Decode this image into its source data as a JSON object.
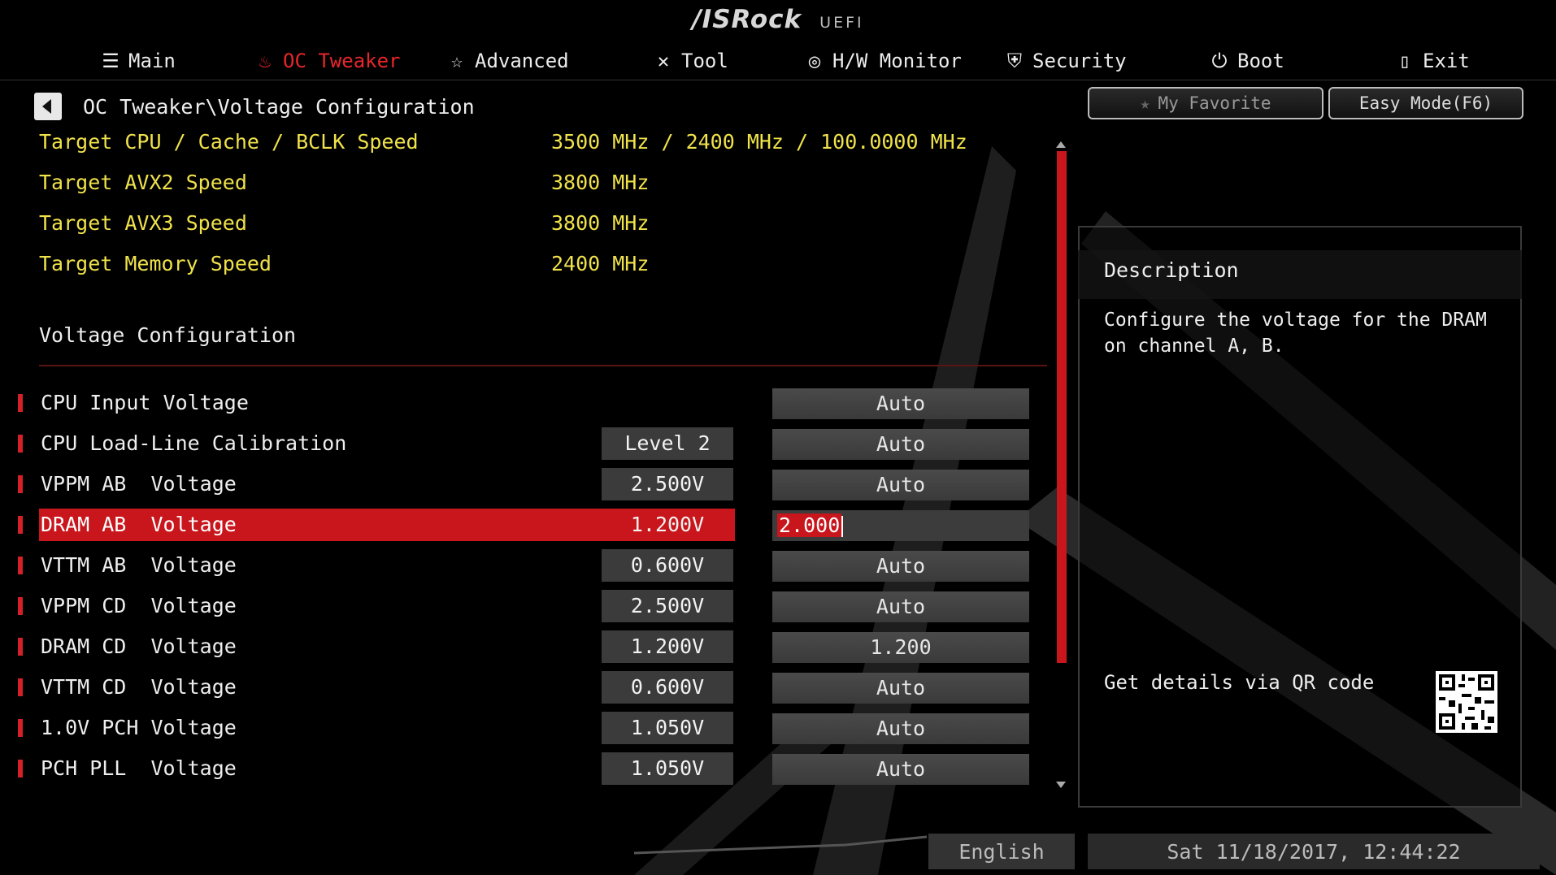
{
  "brand": {
    "logo": "/ISRock",
    "suffix": "UEFI"
  },
  "nav": [
    {
      "label": "Main",
      "icon": "list-icon"
    },
    {
      "label": "OC Tweaker",
      "icon": "flame-icon",
      "active": true
    },
    {
      "label": "Advanced",
      "icon": "star-icon"
    },
    {
      "label": "Tool",
      "icon": "tools-icon"
    },
    {
      "label": "H/W Monitor",
      "icon": "monitor-icon"
    },
    {
      "label": "Security",
      "icon": "shield-icon"
    },
    {
      "label": "Boot",
      "icon": "power-icon"
    },
    {
      "label": "Exit",
      "icon": "exit-icon"
    }
  ],
  "breadcrumb": "OC Tweaker\\Voltage Configuration",
  "buttons": {
    "favorite": "My Favorite",
    "easy_mode": "Easy Mode(F6)"
  },
  "targets": [
    {
      "label": "Target CPU / Cache / BCLK Speed",
      "value": "3500 MHz / 2400 MHz / 100.0000 MHz"
    },
    {
      "label": "Target AVX2 Speed",
      "value": "3800 MHz"
    },
    {
      "label": "Target AVX3 Speed",
      "value": "3800 MHz"
    },
    {
      "label": "Target Memory Speed",
      "value": "2400 MHz"
    }
  ],
  "section_title": "Voltage Configuration",
  "rows": [
    {
      "label": "CPU Input Voltage",
      "current": "",
      "setting": "Auto"
    },
    {
      "label": "CPU Load-Line Calibration",
      "current": "Level 2",
      "setting": "Auto"
    },
    {
      "label": "VPPM AB  Voltage",
      "current": "2.500V",
      "setting": "Auto"
    },
    {
      "label": "DRAM AB  Voltage",
      "current": "1.200V",
      "setting": "2.000",
      "selected": true
    },
    {
      "label": "VTTM AB  Voltage",
      "current": "0.600V",
      "setting": "Auto"
    },
    {
      "label": "VPPM CD  Voltage",
      "current": "2.500V",
      "setting": "Auto"
    },
    {
      "label": "DRAM CD  Voltage",
      "current": "1.200V",
      "setting": "1.200"
    },
    {
      "label": "VTTM CD  Voltage",
      "current": "0.600V",
      "setting": "Auto"
    },
    {
      "label": "1.0V PCH Voltage",
      "current": "1.050V",
      "setting": "Auto"
    },
    {
      "label": "PCH PLL  Voltage",
      "current": "1.050V",
      "setting": "Auto"
    }
  ],
  "description": {
    "title": "Description",
    "text": "Configure the voltage for the DRAM on channel A, B.",
    "qr_label": "Get details via QR code"
  },
  "footer": {
    "language": "English",
    "datetime": "Sat 11/18/2017, 12:44:22"
  },
  "colors": {
    "accent": "#c8161c",
    "highlight_text": "#f0e24a"
  }
}
